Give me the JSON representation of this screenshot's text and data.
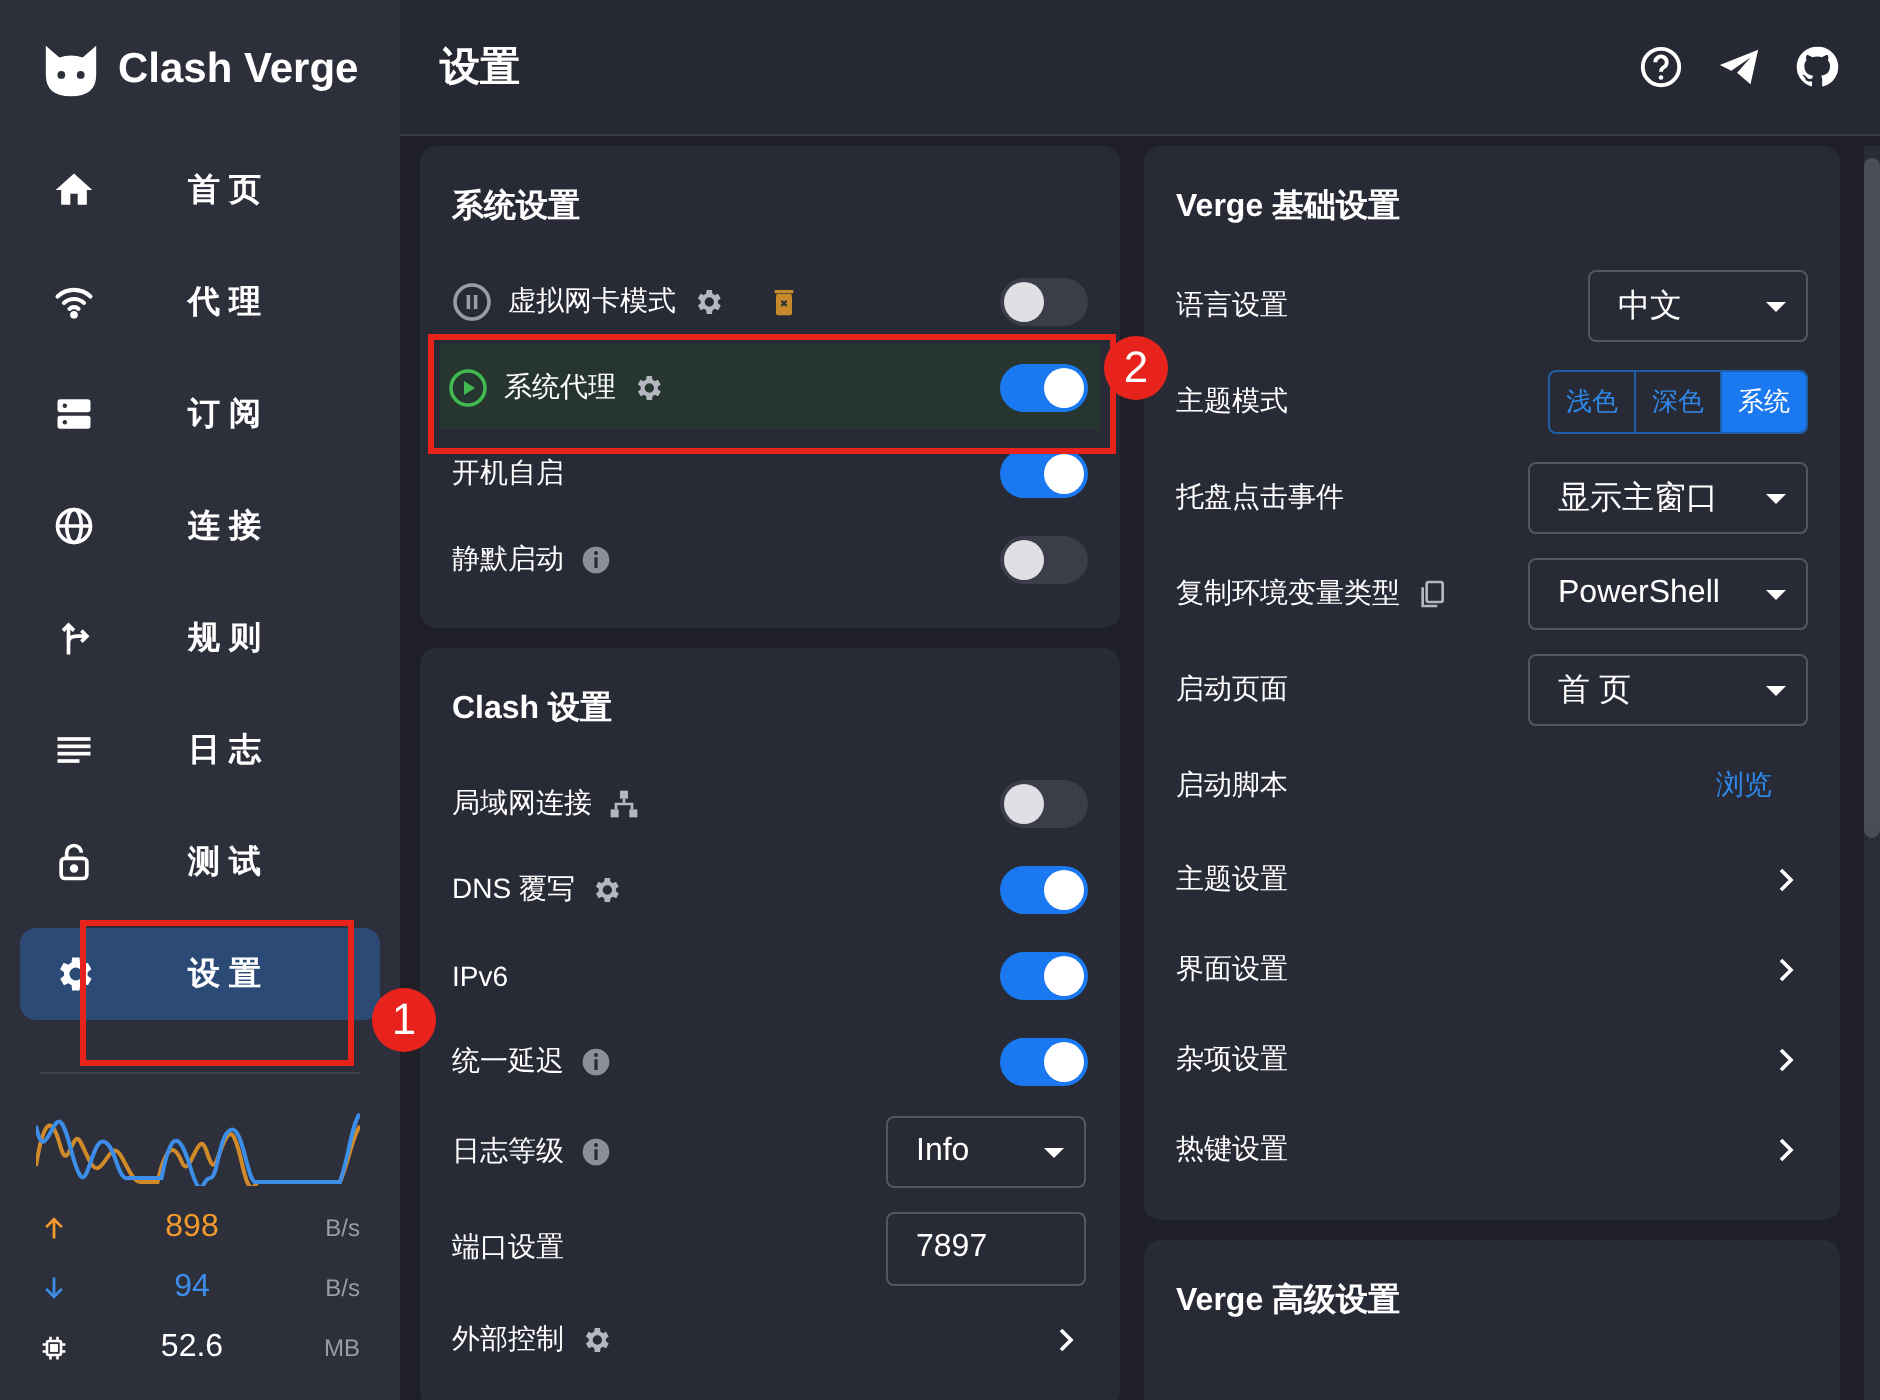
{
  "sidebar": {
    "app_name": "Clash Verge",
    "items": [
      {
        "label": "首 页",
        "selected": false
      },
      {
        "label": "代 理",
        "selected": false
      },
      {
        "label": "订 阅",
        "selected": false
      },
      {
        "label": "连 接",
        "selected": false
      },
      {
        "label": "规 则",
        "selected": false
      },
      {
        "label": "日 志",
        "selected": false
      },
      {
        "label": "测 试",
        "selected": false
      },
      {
        "label": "设 置",
        "selected": true
      }
    ],
    "traffic": [
      {
        "kind": "upload",
        "value": "898",
        "unit": "B/s"
      },
      {
        "kind": "download",
        "value": "94",
        "unit": "B/s"
      },
      {
        "kind": "memory",
        "value": "52.6",
        "unit": "MB"
      }
    ]
  },
  "header": {
    "title": "设置"
  },
  "columns": [
    {
      "cards": [
        {
          "title": "系统设置",
          "rows": [
            {
              "kind": "toggle",
              "label": "虚拟网卡模式",
              "running": false,
              "settings": true,
              "trash": true,
              "on": false,
              "highlighted": false
            },
            {
              "kind": "toggle",
              "label": "系统代理",
              "running": true,
              "settings": true,
              "on": true,
              "highlighted": true
            },
            {
              "kind": "toggle",
              "label": "开机自启",
              "on": true,
              "highlighted": false
            },
            {
              "kind": "toggle",
              "label": "静默启动",
              "info": true,
              "on": false,
              "highlighted": false
            }
          ]
        },
        {
          "title": "Clash 设置",
          "rows": [
            {
              "kind": "toggle",
              "label": "局域网连接",
              "network": true,
              "on": false,
              "highlighted": false
            },
            {
              "kind": "toggle",
              "label": "DNS 覆写",
              "settings": true,
              "on": true,
              "highlighted": false
            },
            {
              "kind": "toggle",
              "label": "IPv6",
              "on": true,
              "highlighted": false
            },
            {
              "kind": "toggle",
              "label": "统一延迟",
              "info": true,
              "on": true,
              "highlighted": false
            },
            {
              "kind": "select",
              "label": "日志等级",
              "info": true,
              "value": "Info"
            },
            {
              "kind": "input",
              "label": "端口设置",
              "value": "7897"
            },
            {
              "kind": "arrow",
              "label": "外部控制",
              "settings": true
            }
          ]
        }
      ]
    },
    {
      "cards": [
        {
          "title": "Verge 基础设置",
          "rows": [
            {
              "kind": "select",
              "label": "语言设置",
              "value": "中文"
            },
            {
              "kind": "segmented",
              "label": "主题模式",
              "options": [
                {
                  "label": "浅色",
                  "selected": false
                },
                {
                  "label": "深色",
                  "selected": false
                },
                {
                  "label": "系统",
                  "selected": true
                }
              ]
            },
            {
              "kind": "select",
              "label": "托盘点击事件",
              "value": "显示主窗口"
            },
            {
              "kind": "select",
              "label": "复制环境变量类型",
              "copy": true,
              "value": "PowerShell"
            },
            {
              "kind": "select",
              "label": "启动页面",
              "value": "首 页"
            },
            {
              "kind": "link",
              "label": "启动脚本",
              "value": "浏览"
            },
            {
              "kind": "arrow",
              "label": "主题设置"
            },
            {
              "kind": "arrow",
              "label": "界面设置"
            },
            {
              "kind": "arrow",
              "label": "杂项设置"
            },
            {
              "kind": "arrow",
              "label": "热键设置"
            }
          ]
        },
        {
          "title": "Verge 高级设置"
        }
      ]
    }
  ],
  "annotations": [
    {
      "label": "1"
    },
    {
      "label": "2"
    }
  ]
}
